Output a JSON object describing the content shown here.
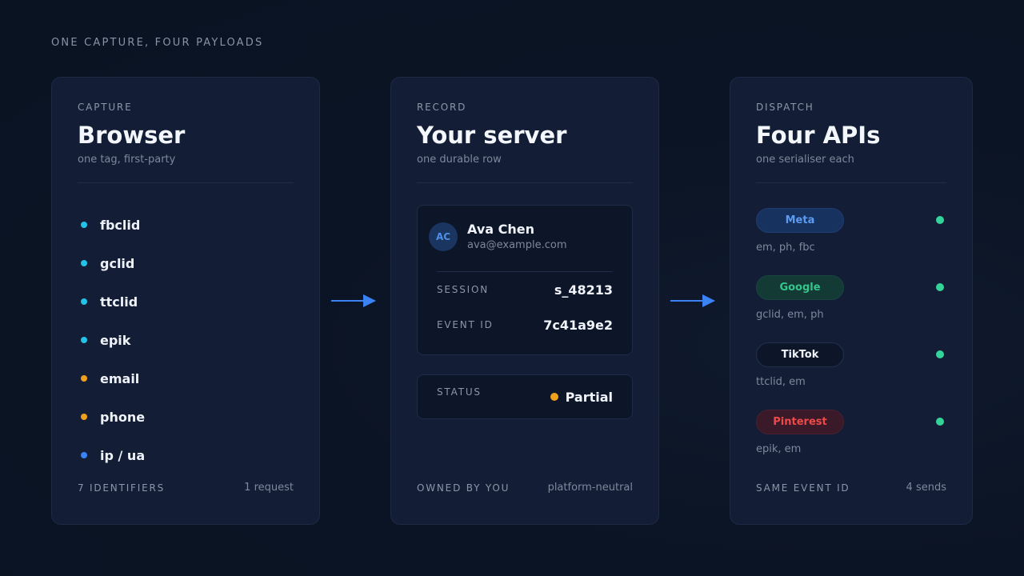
{
  "eyebrow": "ONE CAPTURE, FOUR PAYLOADS",
  "capture": {
    "kicker": "CAPTURE",
    "title": "Browser",
    "subtitle": "one tag, first-party",
    "identifiers": [
      {
        "label": "fbclid",
        "color": "#22c3e6"
      },
      {
        "label": "gclid",
        "color": "#22c3e6"
      },
      {
        "label": "ttclid",
        "color": "#22c3e6"
      },
      {
        "label": "epik",
        "color": "#22c3e6"
      },
      {
        "label": "email",
        "color": "#f0a01c"
      },
      {
        "label": "phone",
        "color": "#f0a01c"
      },
      {
        "label": "ip / ua",
        "color": "#3b82f6"
      }
    ],
    "footer_left": "7 IDENTIFIERS",
    "footer_right": "1 request"
  },
  "record": {
    "kicker": "RECORD",
    "title": "Your server",
    "subtitle": "one durable row",
    "avatar_initials": "AC",
    "name": "Ava Chen",
    "email": "ava@example.com",
    "session_label": "SESSION",
    "session_value": "s_48213",
    "event_label": "EVENT ID",
    "event_value": "7c41a9e2",
    "status_label": "STATUS",
    "status_value": "Partial",
    "status_color": "#f0a01c",
    "footer_left": "OWNED BY YOU",
    "footer_right": "platform-neutral"
  },
  "dispatch": {
    "kicker": "DISPATCH",
    "title": "Four APIs",
    "subtitle": "one serialiser each",
    "apis": [
      {
        "name": "Meta",
        "fields": "em, ph, fbc",
        "bg": "#183260",
        "fg": "#5b9bf0",
        "border": "#1f3d72",
        "dot": "#34d399"
      },
      {
        "name": "Google",
        "fields": "gclid, em, ph",
        "bg": "#143a36",
        "fg": "#34c58a",
        "border": "#184540",
        "dot": "#34d399"
      },
      {
        "name": "TikTok",
        "fields": "ttclid, em",
        "bg": "#0c1628",
        "fg": "#f0f4fa",
        "border": "#22304c",
        "dot": "#34d399"
      },
      {
        "name": "Pinterest",
        "fields": "epik, em",
        "bg": "#3a1a28",
        "fg": "#ef4a4a",
        "border": "#4a2030",
        "dot": "#34d399"
      }
    ],
    "footer_left": "SAME EVENT ID",
    "footer_right": "4 sends"
  },
  "colors": {
    "arrow": "#3b82f6"
  }
}
